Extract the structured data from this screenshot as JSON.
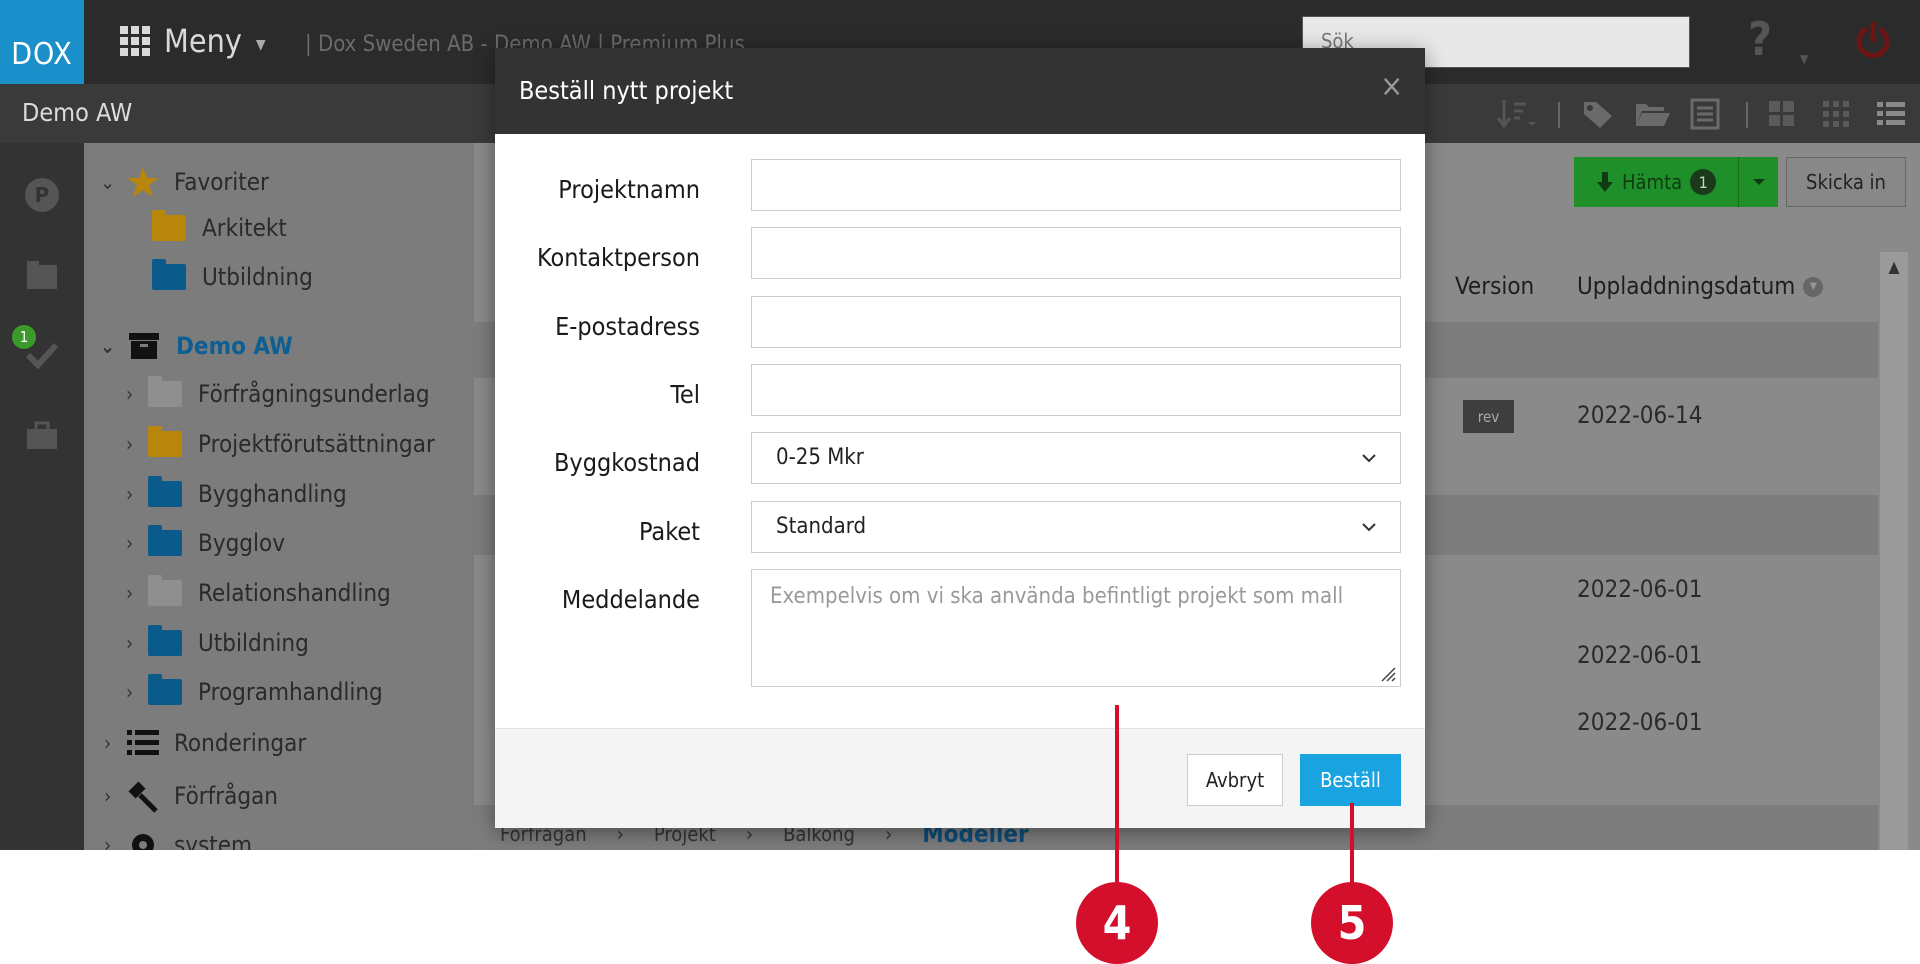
{
  "topbar": {
    "logo": "DOX",
    "menu_label": "Meny",
    "account_title": "| Dox Sweden AB - Demo AW | Premium Plus",
    "search_placeholder": "Sök",
    "help_label": "?"
  },
  "subbar": {
    "title": "Demo AW"
  },
  "rail": {
    "badge_count": "1"
  },
  "tree": {
    "favorites": {
      "label": "Favoriter",
      "items": [
        {
          "label": "Arkitekt",
          "color": "#b8860b"
        },
        {
          "label": "Utbildning",
          "color": "#0b5a8c"
        }
      ]
    },
    "project": {
      "label": "Demo AW",
      "items": [
        {
          "label": "Förfrågningsunderlag",
          "color": "#8f8f8f"
        },
        {
          "label": "Projektförutsättningar",
          "color": "#b8860b"
        },
        {
          "label": "Bygghandling",
          "color": "#0b5a8c"
        },
        {
          "label": "Bygglov",
          "color": "#0b5a8c"
        },
        {
          "label": "Relationshandling",
          "color": "#8f8f8f"
        },
        {
          "label": "Utbildning",
          "color": "#0b5a8c"
        },
        {
          "label": "Programhandling",
          "color": "#0b5a8c"
        }
      ]
    },
    "extra": [
      {
        "label": "Ronderingar"
      },
      {
        "label": "Förfrågan"
      },
      {
        "label": "system"
      }
    ]
  },
  "main": {
    "download_label": "Hämta",
    "download_count": "1",
    "submit_label": "Skicka in",
    "col_version": "Version",
    "col_upload": "Uppladdningsdatum",
    "rev_badge": "rev",
    "dates": [
      "2022-06-14",
      "2022-06-01",
      "2022-06-01",
      "2022-06-01"
    ],
    "breadcrumb": [
      "Förfrågan",
      "Projekt",
      "Balkong",
      "Modeller"
    ]
  },
  "modal": {
    "title": "Beställ nytt projekt",
    "close": "×",
    "fields": {
      "project_name": {
        "label": "Projektnamn",
        "value": ""
      },
      "contact": {
        "label": "Kontaktperson",
        "value": ""
      },
      "email": {
        "label": "E-postadress",
        "value": ""
      },
      "phone": {
        "label": "Tel",
        "value": ""
      },
      "cost": {
        "label": "Byggkostnad",
        "value": "0-25 Mkr"
      },
      "package": {
        "label": "Paket",
        "value": "Standard"
      },
      "message": {
        "label": "Meddelande",
        "placeholder": "Exempelvis om vi ska använda befintligt projekt som mall"
      }
    },
    "cancel_label": "Avbryt",
    "order_label": "Beställ"
  },
  "callouts": [
    "4",
    "5"
  ],
  "colors": {
    "accent_blue": "#19a3e0",
    "callout_red": "#d40f2b",
    "download_green": "#1f8f2a"
  }
}
